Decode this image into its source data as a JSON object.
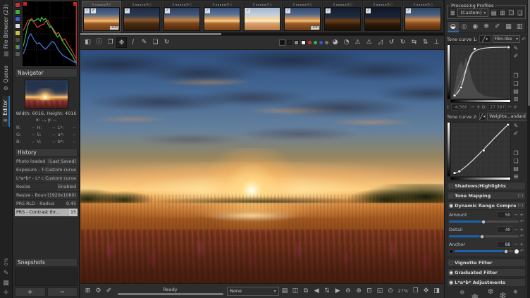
{
  "left_rail": {
    "tabs": [
      {
        "label": "File Browser (23)"
      },
      {
        "label": "Queue"
      },
      {
        "label": "Editor"
      }
    ],
    "progress": "0%"
  },
  "navigator": {
    "title": "Navigator",
    "size_line": "Width: 6016, Height: 4016",
    "xy_line": "x: --, y: --",
    "cells": [
      {
        "l": "R:",
        "v": "--"
      },
      {
        "l": "H:",
        "v": "--"
      },
      {
        "l": "L*:",
        "v": "--"
      },
      {
        "l": "G:",
        "v": "--"
      },
      {
        "l": "S:",
        "v": "--"
      },
      {
        "l": "a*:",
        "v": "--"
      },
      {
        "l": "B:",
        "v": "--"
      },
      {
        "l": "V:",
        "v": "--"
      },
      {
        "l": "b*:",
        "v": "--"
      }
    ]
  },
  "history": {
    "title": "History",
    "rows": [
      {
        "name": "Photo loaded",
        "value": "(Last Saved)"
      },
      {
        "name": "Exposure - Tone c...",
        "value": "Custom curve"
      },
      {
        "name": "L*a*b* - L* curve",
        "value": "Custom curve"
      },
      {
        "name": "Resize",
        "value": "Enabled"
      },
      {
        "name": "Resize - Bounding...",
        "value": "(1920x1080)"
      },
      {
        "name": "PRS RLD - Radius",
        "value": "0.45"
      },
      {
        "name": "PRS - Contrast thr...",
        "value": "15"
      }
    ]
  },
  "snapshots": {
    "title": "Snapshots",
    "add": "+",
    "remove": "−"
  },
  "filmstrip": {
    "check": "✓",
    "hdr": "HDR"
  },
  "statusbar": {
    "status": "Ready",
    "profile": "None",
    "zoom": "27%"
  },
  "profiles": {
    "title": "Processing Profiles",
    "selected": "(Custom)"
  },
  "tone_curve1": {
    "label": "Tone curve 1:",
    "mode": "Film-like",
    "i_label": "I:",
    "i_value": "4.566",
    "o_label": "O:",
    "o_value": "27.397"
  },
  "tone_curve2": {
    "label": "Tone curve 2:",
    "mode": "Weighte...andard"
  },
  "tools": {
    "shadows": "Shadows/Highlights",
    "tonemap": "Tone Mapping",
    "drc": "Dynamic Range Compression",
    "ratio": "1:1",
    "vignette": "Vignette Filter",
    "graduated": "Graduated Filter",
    "lab": "L*a*b* Adjustments"
  },
  "sliders": [
    {
      "label": "Amount",
      "value": "50"
    },
    {
      "label": "Detail",
      "value": "40"
    },
    {
      "label": "Anchor",
      "value": "88"
    }
  ],
  "colors": {
    "accent": "#2a6cb0",
    "slider_fill": "#1c62aa",
    "clipping": "#cc2222"
  },
  "icons": {
    "fb_tab": "▤",
    "queue_tab": "⚙",
    "editor_tab": "≡",
    "rail_i1": "✎",
    "rail_i2": "▦",
    "rail_i3": "✛",
    "menu": "≣",
    "folder": "▤",
    "save": "⊞",
    "copy": "❐",
    "paste": "❑",
    "dropdown": "▾",
    "curve_mini": "╱",
    "reset": "↶",
    "minus": "−",
    "plus": "+",
    "pencil": "✎",
    "pencil2": "✐",
    "tab1": "◒",
    "tab2": "◎",
    "tab3": "◉",
    "tab4": "❋",
    "tab5": "✐",
    "tab6": "▦",
    "tab7": "▥",
    "power_on": "◉",
    "power_off": "○",
    "collapse_left": "◧",
    "info": "ⓘ",
    "docs": "❐",
    "hand": "✥",
    "straighten": "∕",
    "picker": "✎",
    "crop": "❏",
    "rotate": "↻",
    "circle_a": "◕",
    "circle_b": "◔",
    "warn": "⚠",
    "chart": "◿",
    "rot_ccw": "↺",
    "rot_cw": "↻",
    "flip_h": "⇆",
    "flip_v": "⇅",
    "level": "⊥",
    "sb_save": "⊞",
    "sb_queue": "⚙",
    "sb_edit": "✐",
    "open_folder": "▤",
    "before_after": "◫",
    "split_view": "⧉",
    "prev": "◀",
    "updown": "⇅",
    "next": "▶",
    "zoom_out": "⊖",
    "zoom_in": "⊕",
    "zoom_fit": "⊡",
    "zoom_crop": "◱",
    "zoom_100": "⊙",
    "detail_win": "❒",
    "fullscreen": "✥",
    "collapse_right": "◨",
    "key": "¤",
    "clock": "◔",
    "trash": "▯",
    "snow1": "❄",
    "snow2": "❅",
    "snow3": "❆"
  }
}
